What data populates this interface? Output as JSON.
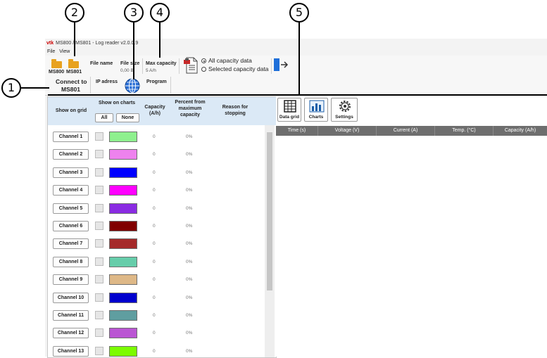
{
  "callouts": [
    "1",
    "2",
    "3",
    "4",
    "5"
  ],
  "window": {
    "logo": "vtk",
    "title": "MS800 / MS801 - Log reader v2.0.0.9"
  },
  "menu": [
    "File",
    "View"
  ],
  "toolbar": {
    "ms800_label": "MS800",
    "ms801_label": "MS801",
    "file_name_label": "File name",
    "file_size_label": "File size",
    "file_size_value": "0,00 B",
    "max_capacity_label": "Max capacity",
    "max_capacity_value": "5 A/h",
    "radio_all": "All capacity data",
    "radio_selected": "Selected capacity data",
    "connect_label_1": "Connect to",
    "connect_label_2": "MS801",
    "ip_label": "IP adress",
    "program_label": "Program"
  },
  "table_header": {
    "show_on_grid": "Show on grid",
    "show_on_charts": "Show on charts",
    "all_button": "All",
    "none_button": "None",
    "capacity": "Capacity",
    "capacity_unit": "(A/h)",
    "percent_1": "Percent from",
    "percent_2": "maximum",
    "percent_3": "capacity",
    "reason_1": "Reason for",
    "reason_2": "stopping"
  },
  "channels": [
    {
      "label": "Channel 1",
      "color": "#8ef08e",
      "capacity": "0",
      "percent": "0%"
    },
    {
      "label": "Channel 2",
      "color": "#ee82ee",
      "capacity": "0",
      "percent": "0%"
    },
    {
      "label": "Channel 3",
      "color": "#0000ff",
      "capacity": "0",
      "percent": "0%"
    },
    {
      "label": "Channel 4",
      "color": "#ff00ff",
      "capacity": "0",
      "percent": "0%"
    },
    {
      "label": "Channel 5",
      "color": "#8a2be2",
      "capacity": "0",
      "percent": "0%"
    },
    {
      "label": "Channel 6",
      "color": "#800000",
      "capacity": "0",
      "percent": "0%"
    },
    {
      "label": "Channel 7",
      "color": "#a52a2a",
      "capacity": "0",
      "percent": "0%"
    },
    {
      "label": "Channel 8",
      "color": "#66cdaa",
      "capacity": "0",
      "percent": "0%"
    },
    {
      "label": "Channel 9",
      "color": "#deb887",
      "capacity": "0",
      "percent": "0%"
    },
    {
      "label": "Channel 10",
      "color": "#0000cd",
      "capacity": "0",
      "percent": "0%"
    },
    {
      "label": "Channel 11",
      "color": "#5f9ea0",
      "capacity": "0",
      "percent": "0%"
    },
    {
      "label": "Channel 12",
      "color": "#ba55d3",
      "capacity": "0",
      "percent": "0%"
    },
    {
      "label": "Channel 13",
      "color": "#7cfc00",
      "capacity": "0",
      "percent": "0%"
    }
  ],
  "tabs": {
    "data_grid": "Data grid",
    "charts": "Charts",
    "settings": "Settings"
  },
  "grid_columns": [
    "Time (s)",
    "Voltage (V)",
    "Current (A)",
    "Temp. (°C)",
    "Capacity (A/h)"
  ]
}
